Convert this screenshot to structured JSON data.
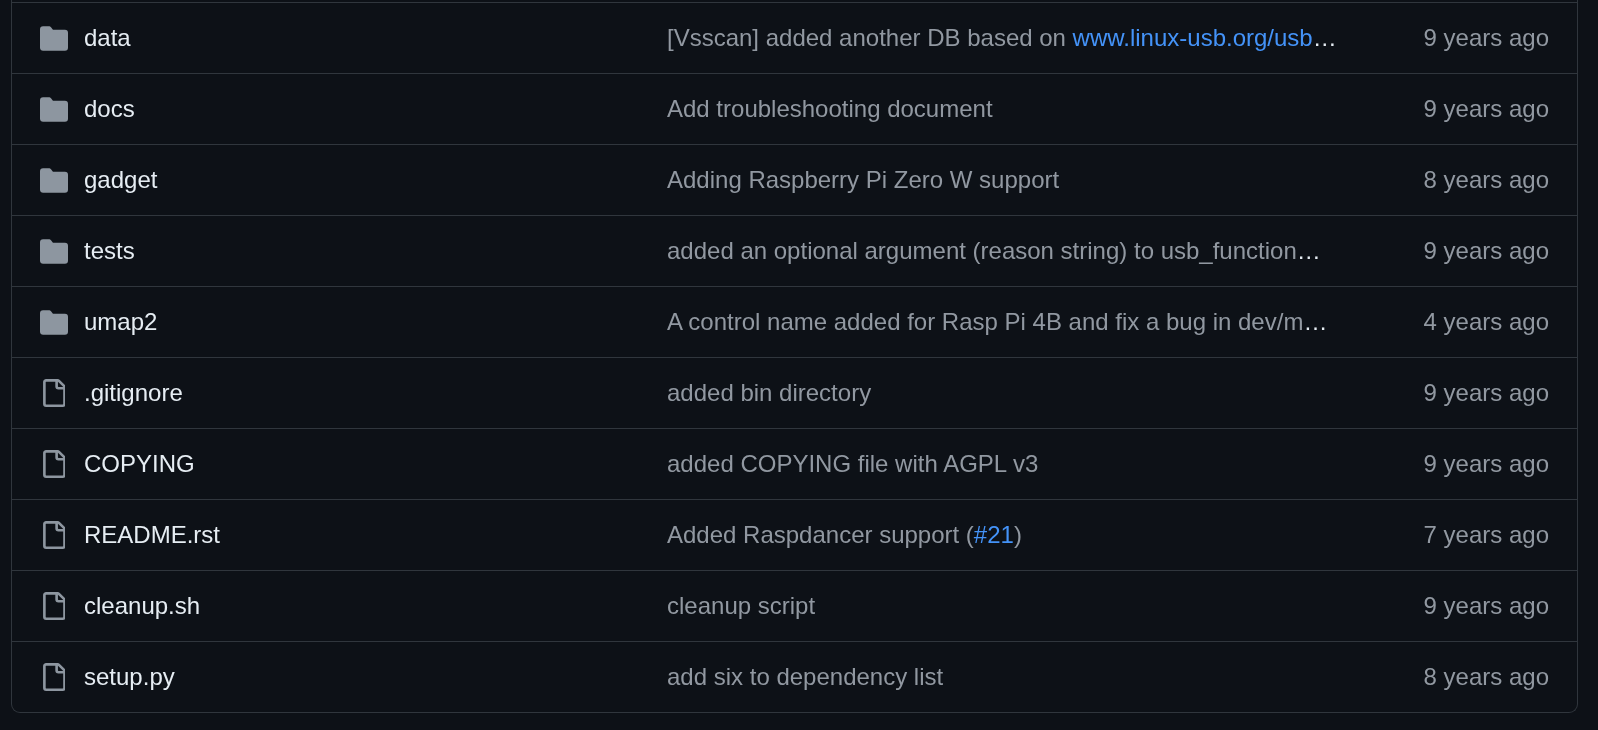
{
  "file_list": {
    "rows": [
      {
        "kind": "folder",
        "name": "data",
        "message": [
          {
            "kind": "text",
            "text": "[Vsscan] added another DB based on "
          },
          {
            "kind": "link",
            "text": "www.linux-usb.org/usb"
          },
          {
            "kind": "ellipsis",
            "text": "…"
          }
        ],
        "date": "9 years ago"
      },
      {
        "kind": "folder",
        "name": "docs",
        "message": [
          {
            "kind": "text",
            "text": "Add troubleshooting document"
          }
        ],
        "date": "9 years ago"
      },
      {
        "kind": "folder",
        "name": "gadget",
        "message": [
          {
            "kind": "text",
            "text": "Adding Raspberry Pi Zero W support"
          }
        ],
        "date": "8 years ago"
      },
      {
        "kind": "folder",
        "name": "tests",
        "message": [
          {
            "kind": "text",
            "text": "added an optional argument (reason string) to usb_function"
          },
          {
            "kind": "ellipsis",
            "text": "…"
          }
        ],
        "date": "9 years ago"
      },
      {
        "kind": "folder",
        "name": "umap2",
        "message": [
          {
            "kind": "text",
            "text": "A control name added for Rasp Pi 4B and fix a bug in dev/m"
          },
          {
            "kind": "ellipsis",
            "text": "…"
          }
        ],
        "date": "4 years ago"
      },
      {
        "kind": "file",
        "name": ".gitignore",
        "message": [
          {
            "kind": "text",
            "text": "added bin directory"
          }
        ],
        "date": "9 years ago"
      },
      {
        "kind": "file",
        "name": "COPYING",
        "message": [
          {
            "kind": "text",
            "text": "added COPYING file with AGPL v3"
          }
        ],
        "date": "9 years ago"
      },
      {
        "kind": "file",
        "name": "README.rst",
        "message": [
          {
            "kind": "text",
            "text": "Added Raspdancer support ("
          },
          {
            "kind": "link",
            "text": "#21"
          },
          {
            "kind": "text",
            "text": ")"
          }
        ],
        "date": "7 years ago"
      },
      {
        "kind": "file",
        "name": "cleanup.sh",
        "message": [
          {
            "kind": "text",
            "text": "cleanup script"
          }
        ],
        "date": "9 years ago"
      },
      {
        "kind": "file",
        "name": "setup.py",
        "message": [
          {
            "kind": "text",
            "text": "add six to dependency list"
          }
        ],
        "date": "8 years ago"
      }
    ]
  }
}
